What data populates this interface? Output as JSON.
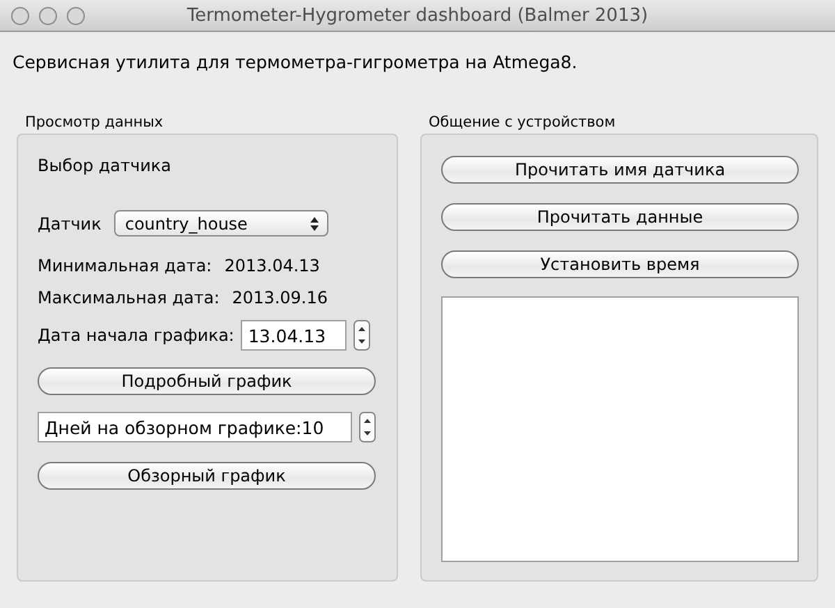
{
  "window": {
    "title": "Termometer-Hygrometer dashboard (Balmer 2013)"
  },
  "description": "Сервисная утилита для термометра-гигрометра на Atmega8.",
  "data_view": {
    "title": "Просмотр данных",
    "heading": "Выбор датчика",
    "sensor": {
      "label": "Датчик",
      "value": "country_house"
    },
    "min_date": {
      "label": "Минимальная дата:",
      "value": "2013.04.13"
    },
    "max_date": {
      "label": "Максимальная дата:",
      "value": "2013.09.16"
    },
    "start_date": {
      "label": "Дата начала графика:",
      "value": "13.04.13"
    },
    "detail_button": "Подробный график",
    "days_field": {
      "value": "Дней на обзорном графике:10"
    },
    "overview_button": "Обзорный график"
  },
  "device": {
    "title": "Общение с устройством",
    "buttons": [
      "Прочитать имя датчика",
      "Прочитать данные",
      "Установить время"
    ]
  }
}
